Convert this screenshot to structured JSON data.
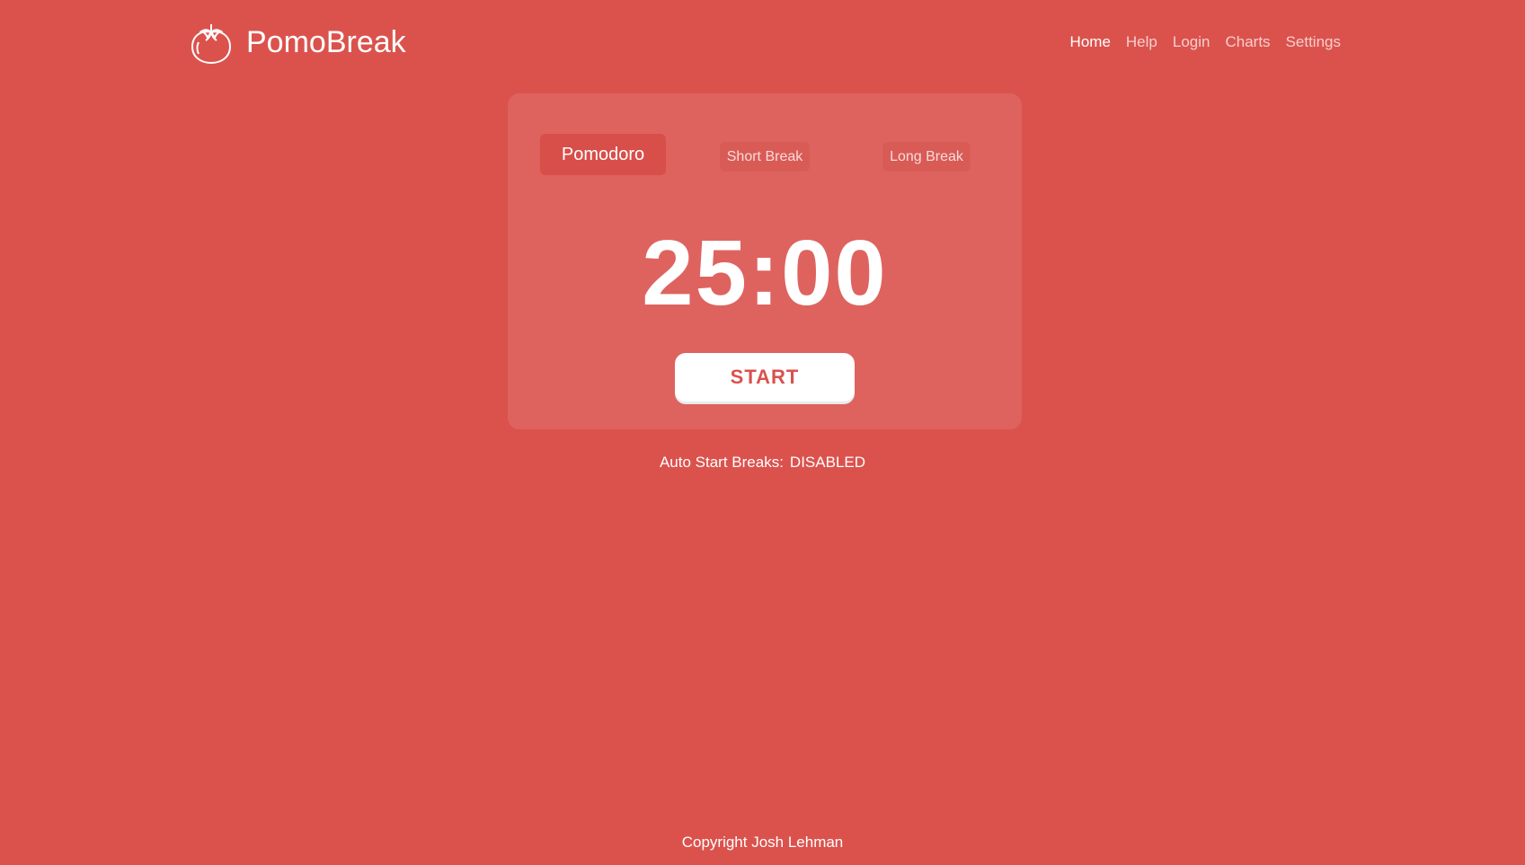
{
  "header": {
    "brand_name": "PomoBreak",
    "logo_icon": "tomato-icon",
    "nav": [
      {
        "label": "Home",
        "active": true
      },
      {
        "label": "Help",
        "active": false
      },
      {
        "label": "Login",
        "active": false
      },
      {
        "label": "Charts",
        "active": false
      },
      {
        "label": "Settings",
        "active": false
      }
    ]
  },
  "timer_card": {
    "tabs": [
      {
        "label": "Pomodoro",
        "active": true
      },
      {
        "label": "Short Break",
        "active": false
      },
      {
        "label": "Long Break",
        "active": false
      }
    ],
    "time": "25:00",
    "start_label": "START"
  },
  "auto_start": {
    "label": "Auto Start Breaks:",
    "value": "DISABLED"
  },
  "footer": {
    "copyright": "Copyright Josh Lehman"
  },
  "colors": {
    "background": "#db524d",
    "card": "#df625d",
    "active_tab": "#d84e49",
    "start_text": "#d9524d",
    "text": "#ffffff"
  }
}
